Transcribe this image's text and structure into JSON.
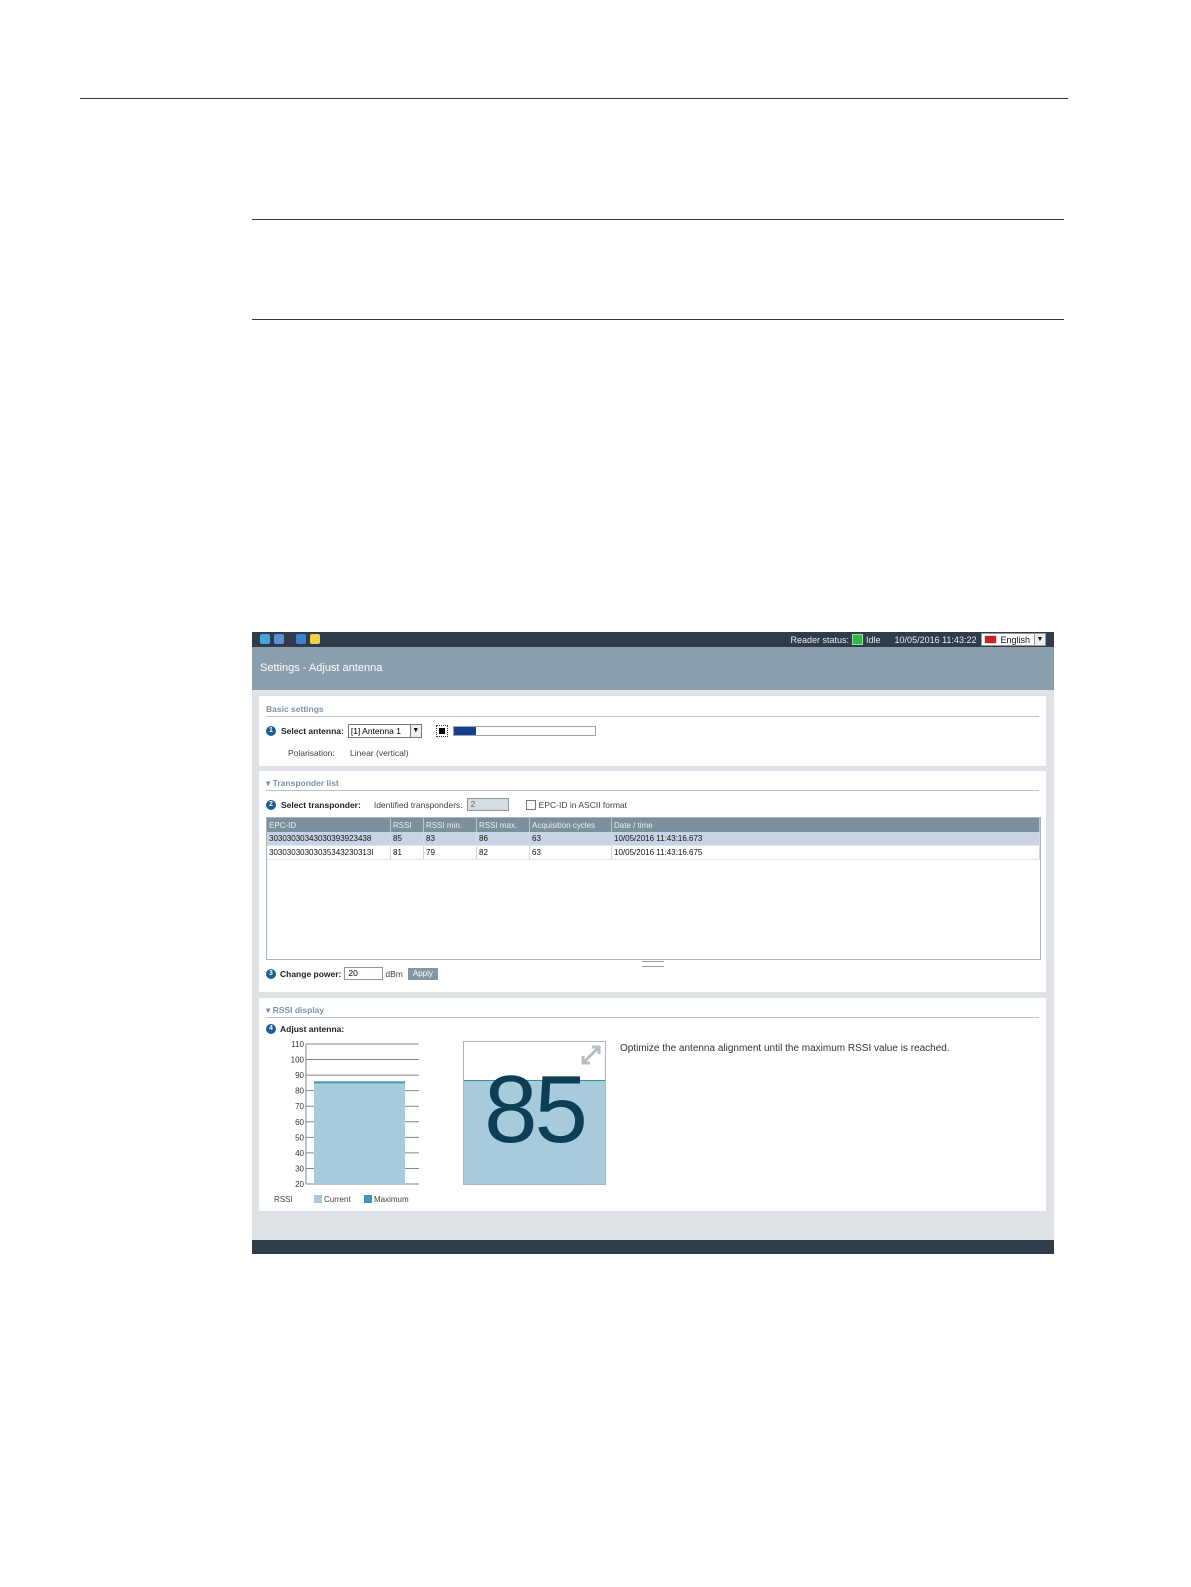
{
  "toolbar": {
    "icons": [
      "refresh-icon",
      "connect-icon",
      "save-icon",
      "folder-icon"
    ]
  },
  "status": {
    "label": "Reader status:",
    "value": "Idle",
    "timestamp": "10/05/2016 11:43:22",
    "language": "English"
  },
  "page": {
    "title": "Settings - Adjust antenna"
  },
  "basic": {
    "title": "Basic settings",
    "step1": "1",
    "select_label": "Select antenna:",
    "antenna_value": "[1] Antenna 1",
    "polarisation_label": "Polarisation:",
    "polarisation_value": "Linear (vertical)",
    "signal_level": 0.16
  },
  "transponder": {
    "title": "Transponder list",
    "step2": "2",
    "select_label": "Select transponder:",
    "identified_label": "Identified transponders:",
    "identified_value": "2",
    "ascii_label": "EPC-ID in ASCII format",
    "columns": [
      "EPC-ID",
      "RSSI",
      "RSSI min.",
      "RSSI max.",
      "Acquisition cycles",
      "Date / time"
    ],
    "rows": [
      [
        "30303030343030393923438",
        "85",
        "83",
        "86",
        "63",
        "10/05/2016 11:43:16.673"
      ],
      [
        "30303030303035343230313I",
        "81",
        "79",
        "82",
        "63",
        "10/05/2016 11:43:16.675"
      ]
    ],
    "step3": "3",
    "power_label": "Change power:",
    "power_value": "20",
    "power_unit": "dBm",
    "apply_label": "Apply"
  },
  "rssi": {
    "title": "RSSI display",
    "step4": "4",
    "adjust_label": "Adjust antenna:",
    "current_value": "85",
    "hint": "Optimize the antenna alignment until the maximum RSSI value is reached.",
    "legend_rssi": "RSSI",
    "legend_current": "Current",
    "legend_maximum": "Maximum"
  },
  "chart_data": {
    "type": "bar",
    "categories": [
      "RSSI"
    ],
    "series": [
      {
        "name": "Current",
        "values": [
          85
        ]
      },
      {
        "name": "Maximum",
        "values": [
          86
        ]
      }
    ],
    "yticks": [
      110,
      100,
      90,
      80,
      70,
      60,
      50,
      40,
      30,
      20
    ],
    "ylim": [
      20,
      110
    ],
    "colors": {
      "current": "#a7cbda",
      "maximum": "#3f98b5"
    }
  }
}
